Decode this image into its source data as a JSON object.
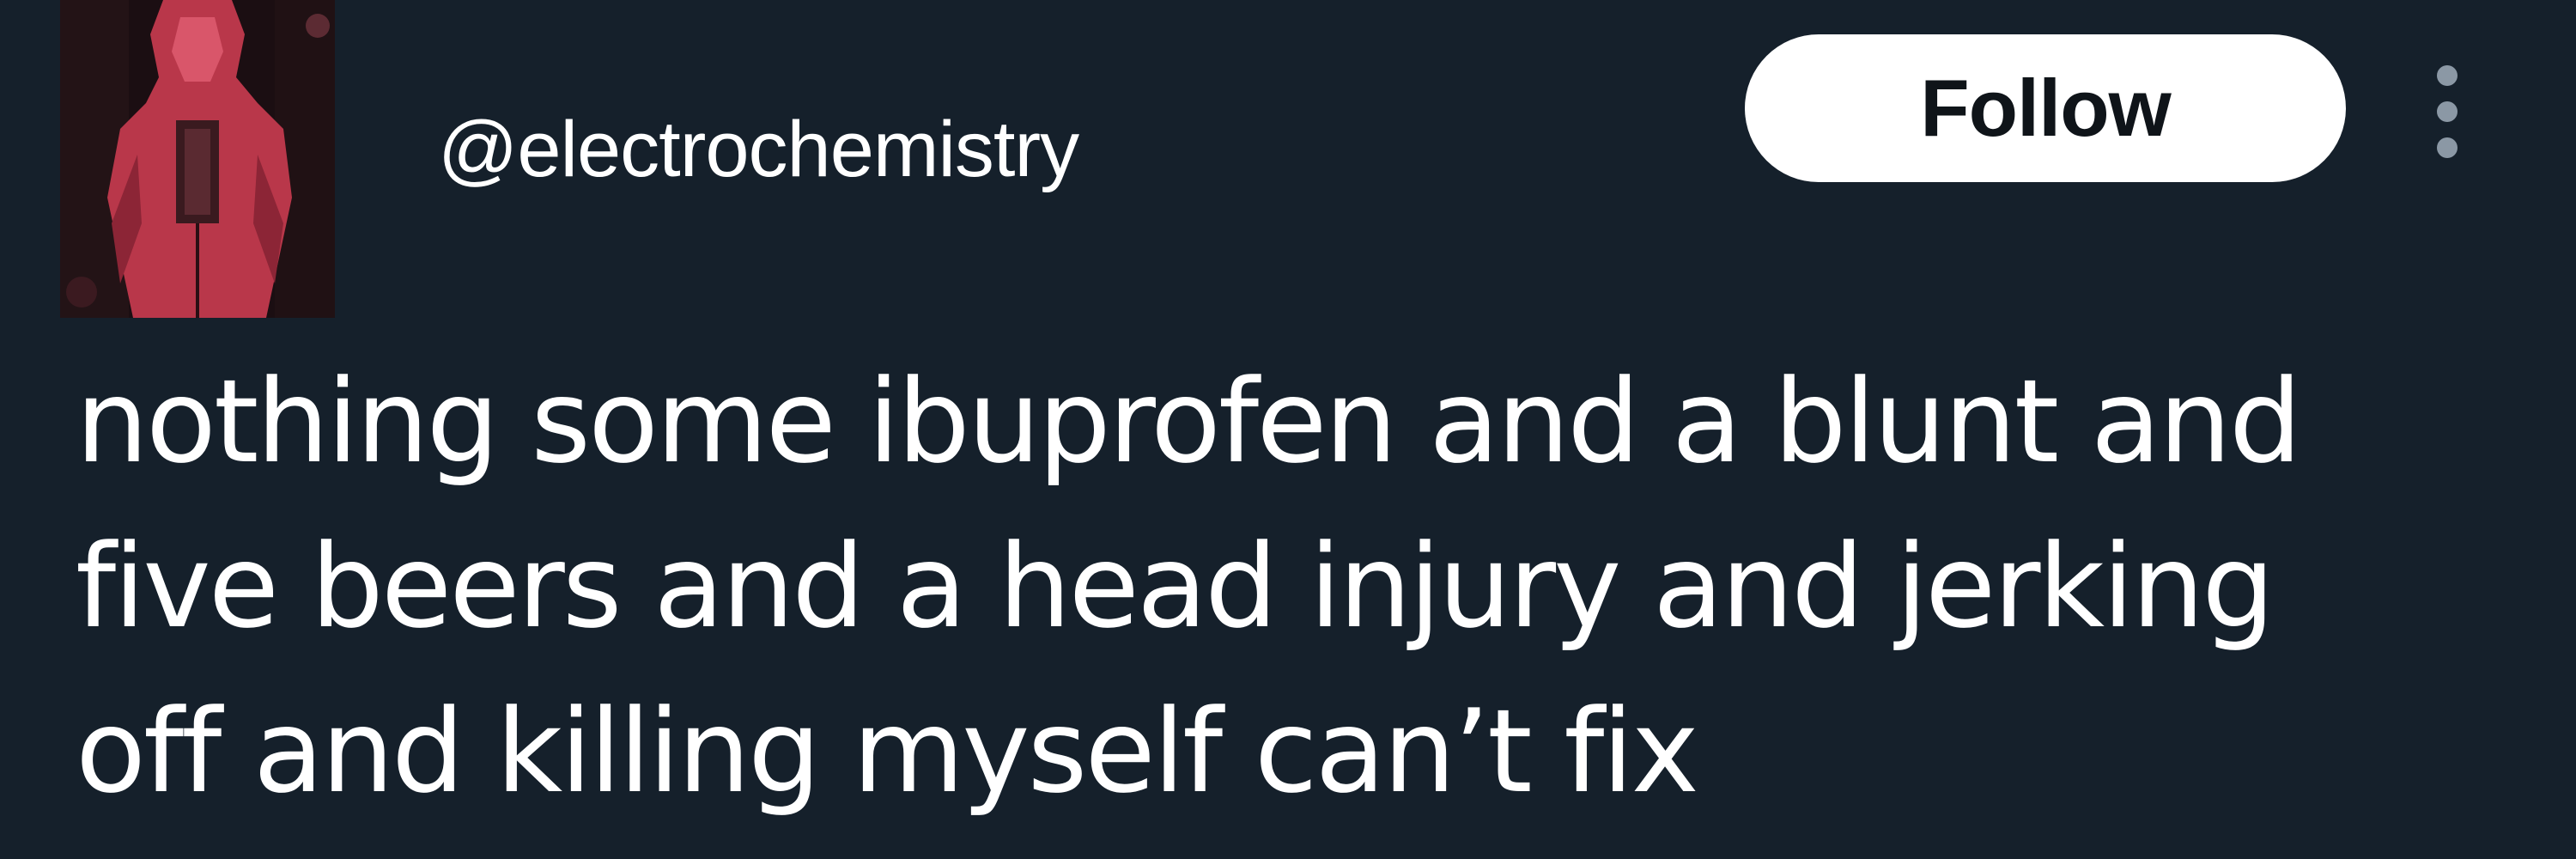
{
  "tweet": {
    "handle": "@electrochemistry",
    "follow_label": "Follow",
    "more_icon": "more-vertical-icon",
    "avatar_icon": "avatar-image",
    "text": "nothing some ibuprofen and a blunt and\nfive beers and a head injury and jerking\noff and killing myself can’t fix"
  },
  "colors": {
    "background": "#15202b",
    "text": "#ffffff",
    "follow_button_bg": "#ffffff",
    "follow_button_text": "#0f1419",
    "more_icon": "#8b98a5"
  }
}
